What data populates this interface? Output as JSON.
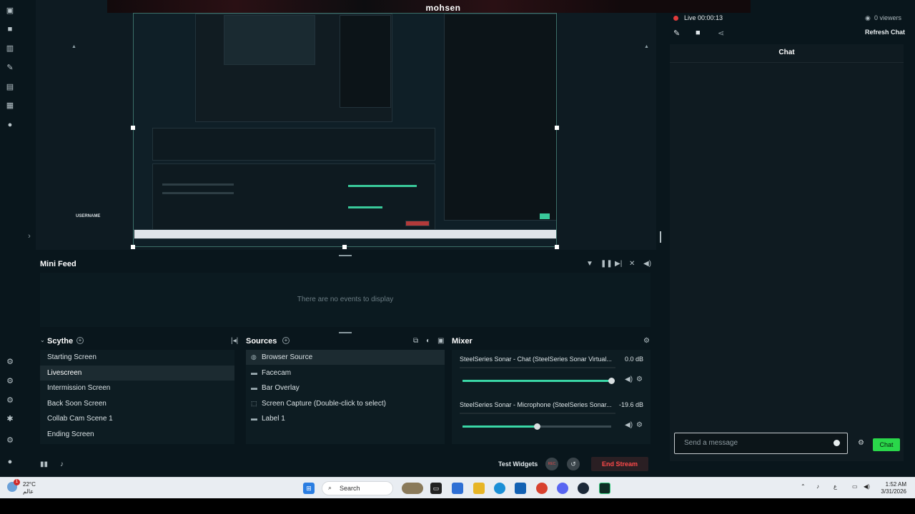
{
  "banner": {
    "streamer_name": "mohsen"
  },
  "preview": {
    "overlay_username": "USERNAME"
  },
  "status": {
    "live_label": "Live 00:00:13",
    "viewers": "0 viewers",
    "refresh_chat": "Refresh Chat"
  },
  "minifeed": {
    "title": "Mini Feed",
    "empty_text": "There are no events to display"
  },
  "scenes": {
    "title": "Scythe",
    "items": [
      "Starting Screen",
      "Livescreen",
      "Intermission Screen",
      "Back Soon Screen",
      "Collab Cam Scene 1",
      "Ending Screen"
    ],
    "active_index": 1
  },
  "sources": {
    "title": "Sources",
    "items": [
      {
        "label": "Browser Source",
        "icon": "globe-icon"
      },
      {
        "label": "Facecam",
        "icon": "folder-icon"
      },
      {
        "label": "Bar Overlay",
        "icon": "folder-icon"
      },
      {
        "label": "Screen Capture (Double-click to select)",
        "icon": "screen-capture-icon"
      },
      {
        "label": "Label 1",
        "icon": "folder-icon"
      }
    ]
  },
  "mixer": {
    "title": "Mixer",
    "channels": [
      {
        "name": "SteelSeries Sonar - Chat (SteelSeries Sonar Virtual...",
        "db": "0.0 dB",
        "level": 1.0
      },
      {
        "name": "SteelSeries Sonar - Microphone (SteelSeries Sonar...",
        "db": "-19.6 dB",
        "level": 0.5
      }
    ]
  },
  "footer": {
    "test_widgets": "Test Widgets",
    "rec": "REC",
    "end_stream": "End Stream"
  },
  "chat": {
    "title": "Chat",
    "input_placeholder": "Send a message",
    "send_label": "Chat"
  },
  "taskbar": {
    "weather_temp": "22°C",
    "weather_label": "عالم",
    "search_label": "Search",
    "lang": "ع",
    "time": "1:52 AM",
    "date": "3/31/2026"
  },
  "colors": {
    "accent_green": "#2ad74a",
    "live_red": "#e03b3b",
    "end_stream_red": "#ff4a4a"
  }
}
